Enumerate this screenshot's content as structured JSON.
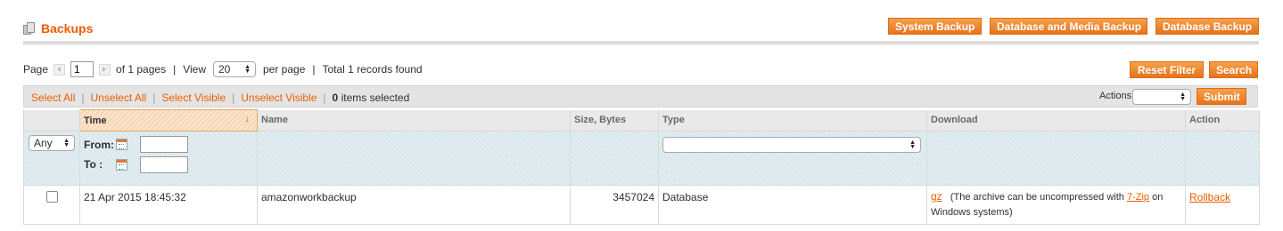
{
  "header": {
    "title": "Backups"
  },
  "toolbar": {
    "system_backup": "System Backup",
    "db_media_backup": "Database and Media Backup",
    "db_backup": "Database Backup"
  },
  "pager": {
    "page_label": "Page",
    "current_page": "1",
    "of_pages": "of 1 pages",
    "view_label": "View",
    "per_page_value": "20",
    "per_page_label": "per page",
    "records_found": "Total 1 records found"
  },
  "grid_actions": {
    "reset_filter": "Reset Filter",
    "search": "Search"
  },
  "massaction": {
    "select_all": "Select All",
    "unselect_all": "Unselect All",
    "select_visible": "Select Visible",
    "unselect_visible": "Unselect Visible",
    "selected_count": "0",
    "selected_suffix": "items selected",
    "actions_label": "Actions",
    "actions_value": "",
    "submit": "Submit"
  },
  "columns": {
    "time": "Time",
    "name": "Name",
    "size": "Size, Bytes",
    "type": "Type",
    "download": "Download",
    "action": "Action"
  },
  "filters": {
    "any": "Any",
    "from_label": "From:",
    "to_label": "To :",
    "type_value": ""
  },
  "rows": [
    {
      "time": "21 Apr 2015 18:45:32",
      "name": "amazonworkbackup",
      "size": "3457024",
      "type": "Database",
      "download_link": "gz",
      "download_note_pre": "(The archive can be uncompressed with ",
      "download_note_link": "7-Zip",
      "download_note_post": " on Windows systems)",
      "action": "Rollback"
    }
  ],
  "colors": {
    "accent": "#eb5e00",
    "button": "#e5741d"
  }
}
